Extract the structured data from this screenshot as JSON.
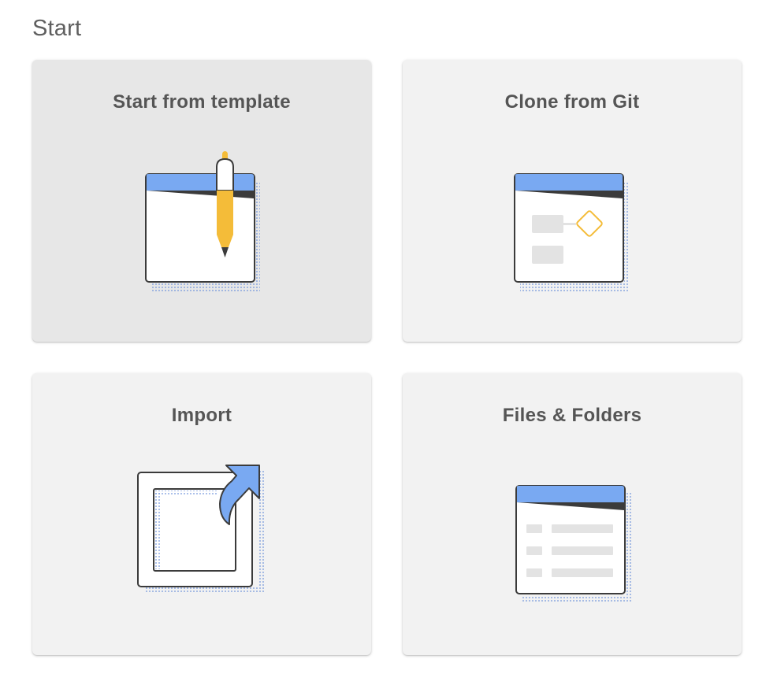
{
  "page": {
    "title": "Start"
  },
  "cards": [
    {
      "label": "Start from template",
      "icon": "template-pen-icon",
      "hovered": true
    },
    {
      "label": "Clone from Git",
      "icon": "git-clone-icon",
      "hovered": false
    },
    {
      "label": "Import",
      "icon": "import-arrow-icon",
      "hovered": false
    },
    {
      "label": "Files & Folders",
      "icon": "files-folders-icon",
      "hovered": false
    }
  ],
  "colors": {
    "accent_blue": "#79a9f2",
    "pen_yellow": "#f4bc39",
    "outline": "#3b3b3b",
    "card_bg": "#f2f2f2",
    "card_hover_bg": "#e7e7e7",
    "title_text": "#555555"
  }
}
